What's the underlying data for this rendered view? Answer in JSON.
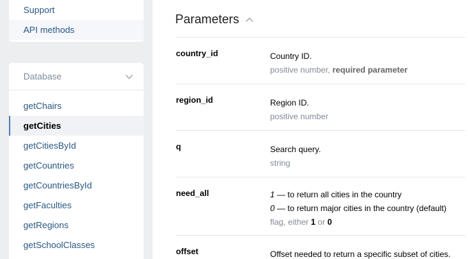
{
  "sidebar": {
    "top_items": [
      {
        "label": "Support"
      },
      {
        "label": "API methods"
      }
    ],
    "database": {
      "title": "Database",
      "items": [
        {
          "label": "getChairs"
        },
        {
          "label": "getCities"
        },
        {
          "label": "getCitiesById"
        },
        {
          "label": "getCountries"
        },
        {
          "label": "getCountriesById"
        },
        {
          "label": "getFaculties"
        },
        {
          "label": "getRegions"
        },
        {
          "label": "getSchoolClasses"
        }
      ],
      "active_index": 1
    }
  },
  "main": {
    "section_title": "Parameters",
    "params": [
      {
        "name": "country_id",
        "description": "Country ID.",
        "type_prefix": "positive number, ",
        "type_strong": "required parameter"
      },
      {
        "name": "region_id",
        "description": "Region ID.",
        "type": "positive number"
      },
      {
        "name": "q",
        "description": "Search query.",
        "type": "string"
      },
      {
        "name": "need_all",
        "opt1_num": "1",
        "opt1_text": " — to return all cities in the country",
        "opt0_num": "0",
        "opt0_text": " — to return major cities in the country (default)",
        "type_prefix": "flag, either ",
        "type_val1": "1",
        "type_mid": " or ",
        "type_val0": "0"
      },
      {
        "name": "offset",
        "description": "Offset needed to return a specific subset of cities."
      }
    ]
  },
  "colors": {
    "link": "#2a5885",
    "muted": "#818c99",
    "accent": "#5181b8",
    "page_bg": "#edeef0"
  },
  "icons": {
    "database_toggle": "chevron-down-icon",
    "section_toggle": "chevron-up-icon"
  }
}
